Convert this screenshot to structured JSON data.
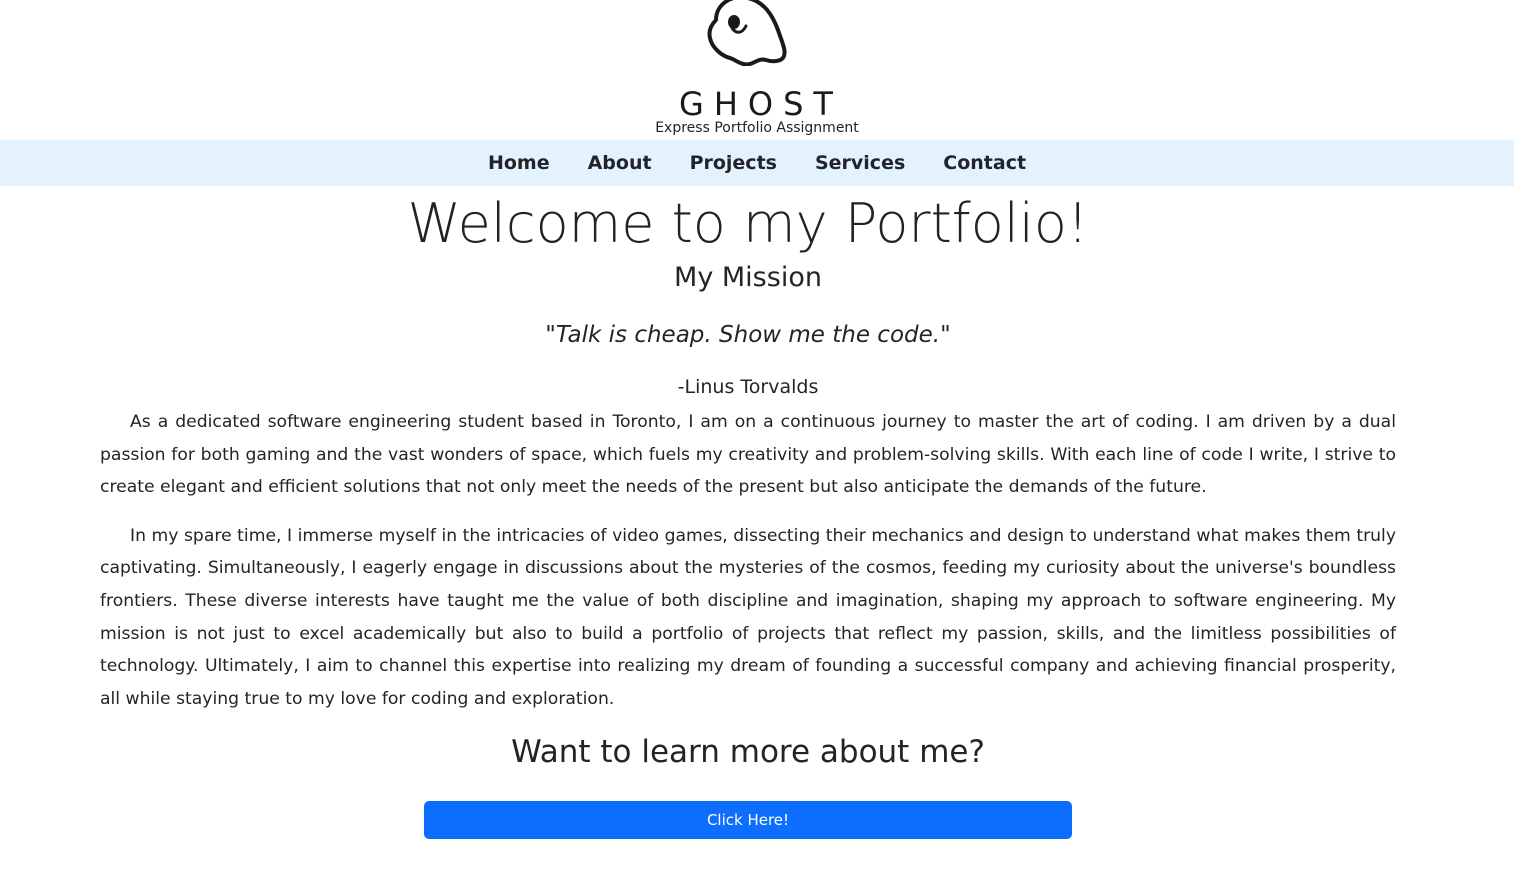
{
  "header": {
    "logo_icon": "ghost-icon",
    "brand": "GHOST",
    "subtitle": "Express Portfolio Assignment"
  },
  "nav": {
    "background": "#e3f2fd",
    "items": [
      {
        "label": "Home"
      },
      {
        "label": "About"
      },
      {
        "label": "Projects"
      },
      {
        "label": "Services"
      },
      {
        "label": "Contact"
      }
    ]
  },
  "main": {
    "title": "Welcome to my Portfolio!",
    "mission_heading": "My Mission",
    "quote": "Talk is cheap. Show me the code.",
    "author": "-Linus Torvalds",
    "paragraphs": [
      "As a dedicated software engineering student based in Toronto, I am on a continuous journey to master the art of coding. I am driven by a dual passion for both gaming and the vast wonders of space, which fuels my creativity and problem-solving skills. With each line of code I write, I strive to create elegant and efficient solutions that not only meet the needs of the present but also anticipate the demands of the future.",
      "In my spare time, I immerse myself in the intricacies of video games, dissecting their mechanics and design to understand what makes them truly captivating. Simultaneously, I eagerly engage in discussions about the mysteries of the cosmos, feeding my curiosity about the universe's boundless frontiers. These diverse interests have taught me the value of both discipline and imagination, shaping my approach to software engineering. My mission is not just to excel academically but also to build a portfolio of projects that reflect my passion, skills, and the limitless possibilities of technology. Ultimately, I aim to channel this expertise into realizing my dream of founding a successful company and achieving financial prosperity, all while staying true to my love for coding and exploration."
    ],
    "cta_heading": "Want to learn more about me?",
    "cta_button": "Click Here!",
    "accent": "#0d6efd"
  }
}
